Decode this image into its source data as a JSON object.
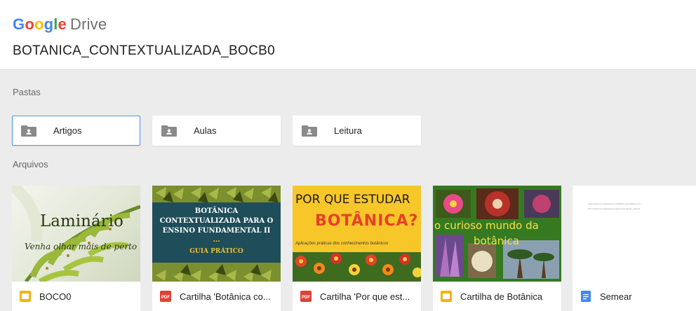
{
  "header": {
    "logo_google": "Google",
    "logo_drive": "Drive",
    "folder_title": "BOTANICA_CONTEXTUALIZADA_BOCB0"
  },
  "sections": {
    "folders_label": "Pastas",
    "files_label": "Arquivos"
  },
  "folders": [
    {
      "label": "Artigos",
      "selected": true
    },
    {
      "label": "Aulas",
      "selected": false
    },
    {
      "label": "Leitura",
      "selected": false
    }
  ],
  "files": [
    {
      "name": "BOCO0",
      "type_icon": "slides-icon",
      "thumb": {
        "title": "Laminário",
        "subtitle": "Venha olhar mais de perto"
      }
    },
    {
      "name": "Cartilha 'Botânica co...",
      "type_icon": "pdf-icon",
      "thumb": {
        "lines": [
          "BOTÂNICA",
          "CONTEXTUALIZADA PARA O",
          "ENSINO FUNDAMENTAL II",
          "...",
          "GUIA PRÁTICO"
        ]
      }
    },
    {
      "name": "Cartilha 'Por que est...",
      "type_icon": "pdf-icon",
      "thumb": {
        "title_line1": "POR QUE ESTUDAR",
        "title_line2": "BOTÂNICA?",
        "subtitle": "Aplicações práticas dos conhecimentos botânicos"
      }
    },
    {
      "name": "Cartilha de Botânica",
      "type_icon": "slides-icon",
      "thumb": {
        "line1": "o curioso mundo da",
        "line2": "botânica"
      }
    },
    {
      "name": "Semear",
      "type_icon": "docs-icon",
      "thumb": {
        "line1": "https://www.semeiabotanica.org/biblioteca/cartilhas_bot_1",
        "line2": "https://www.semeiabotanica.org/recursos/guias_semear"
      }
    }
  ],
  "colors": {
    "selected_border": "#4d90fe",
    "slides": "#f4b400",
    "pdf": "#db4437",
    "docs": "#4285f4"
  }
}
